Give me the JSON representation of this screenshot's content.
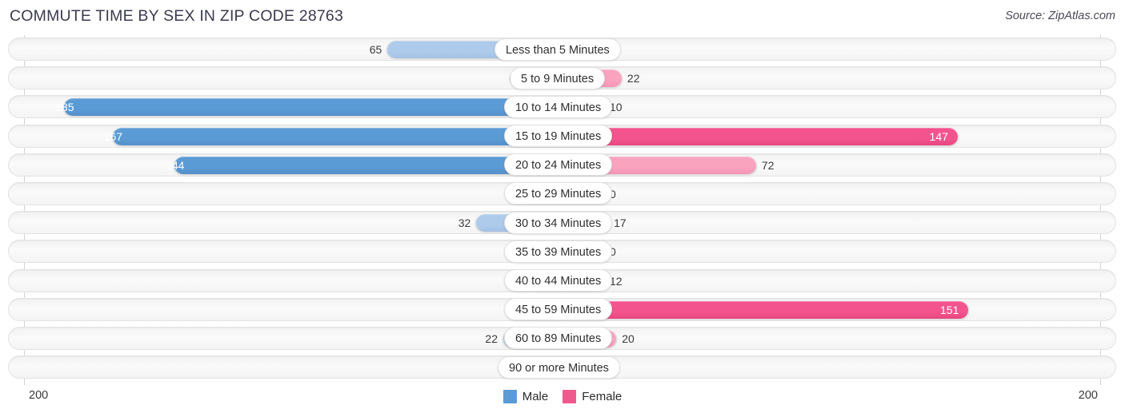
{
  "header": {
    "title": "COMMUTE TIME BY SEX IN ZIP CODE 28763",
    "source": "Source: ZipAtlas.com"
  },
  "axis": {
    "left_tick": "200",
    "right_tick": "200",
    "max": 200
  },
  "legend": {
    "items": [
      {
        "label": "Male",
        "color": "#5b9bd5"
      },
      {
        "label": "Female",
        "color": "#ef5a8e"
      }
    ]
  },
  "colors": {
    "male_strong": "#5b9bd5",
    "male_light": "#aecbeb",
    "female_strong": "#f4548e",
    "female_light": "#f9a3bf",
    "track": "#f5f5f5",
    "axis": "#d2d2d8"
  },
  "chart_data": {
    "type": "bar",
    "orientation": "horizontal-diverging",
    "title": "COMMUTE TIME BY SEX IN ZIP CODE 28763",
    "xlabel": "",
    "ylabel": "",
    "xlim": [
      200,
      200
    ],
    "grid": false,
    "legend_position": "bottom-center",
    "categories": [
      "Less than 5 Minutes",
      "5 to 9 Minutes",
      "10 to 14 Minutes",
      "15 to 19 Minutes",
      "20 to 24 Minutes",
      "25 to 29 Minutes",
      "30 to 34 Minutes",
      "35 to 39 Minutes",
      "40 to 44 Minutes",
      "45 to 59 Minutes",
      "60 to 89 Minutes",
      "90 or more Minutes"
    ],
    "series": [
      {
        "name": "Male",
        "values": [
          65,
          0,
          185,
          167,
          144,
          0,
          32,
          0,
          0,
          0,
          22,
          0
        ]
      },
      {
        "name": "Female",
        "values": [
          0,
          22,
          10,
          147,
          72,
          0,
          17,
          0,
          12,
          151,
          20,
          0
        ]
      }
    ]
  }
}
